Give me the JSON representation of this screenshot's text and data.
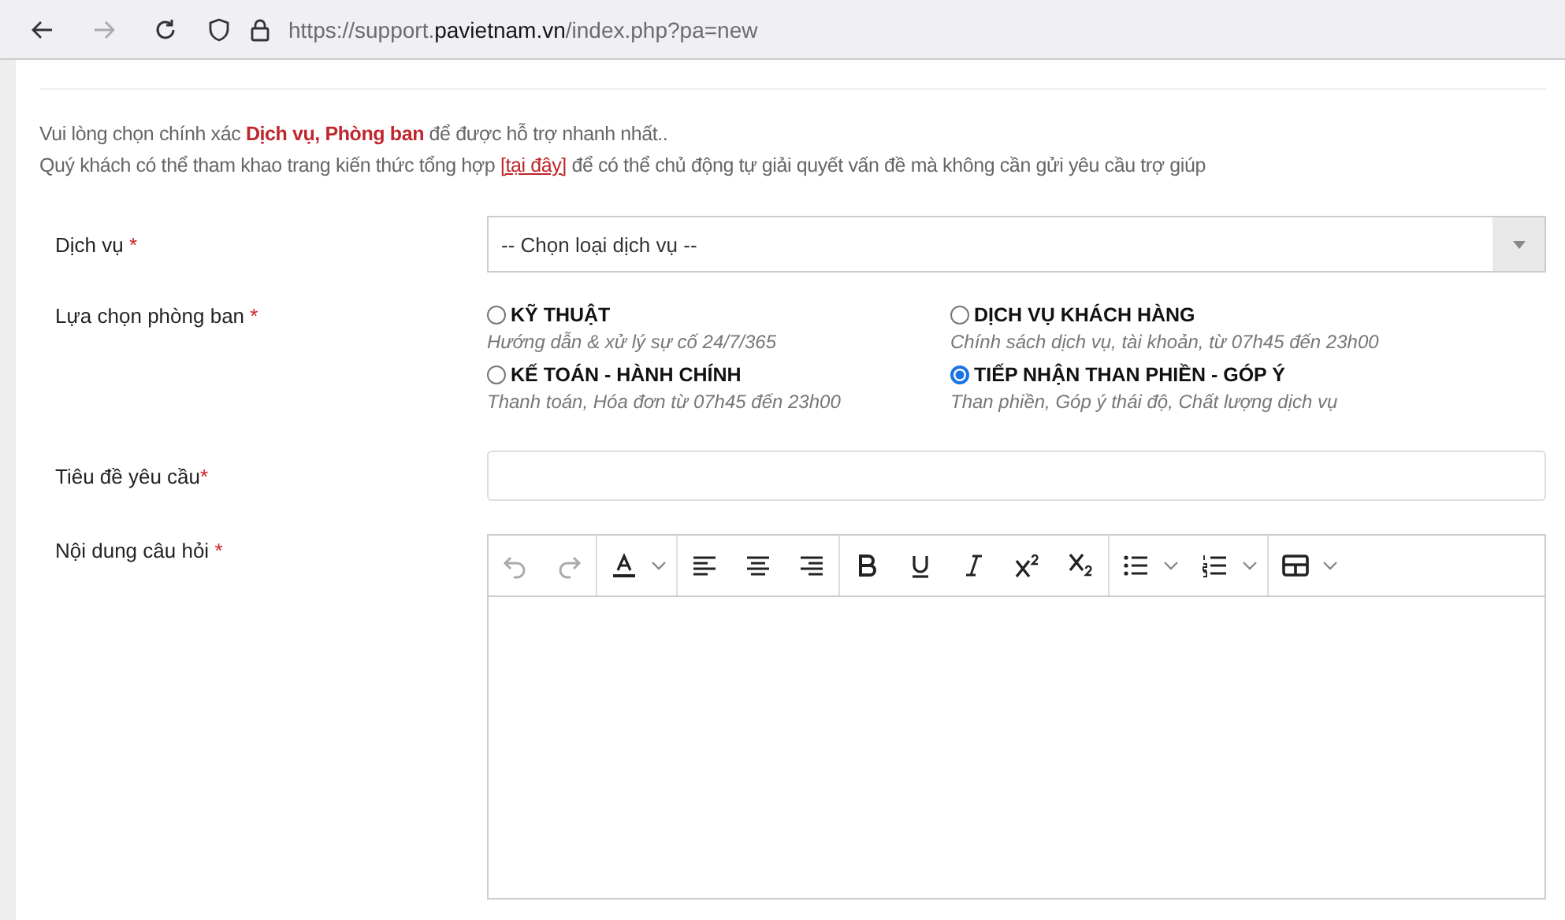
{
  "browser": {
    "url": {
      "scheme": "https://support.",
      "domain": "pavietnam.vn",
      "path": "/index.php?pa=new"
    }
  },
  "intro": {
    "line_1": "Vui lòng chọn chính xác **Dịch vụ, Phòng ban** để được hỗ trợ nhanh nhất..",
    "line_2_before": "Quý khách có thể tham khao trang kiến thức tổng hợp ",
    "line_2_link": "[tại đây]",
    "line_2_after": " để có thể chủ động tự giải quyết vấn đề mà không cần gửi yêu cầu trợ giúp"
  },
  "form": {
    "service": {
      "label": "Dịch vụ",
      "required_mark": "*",
      "placeholder": "-- Chọn loại dịch vụ --"
    },
    "department": {
      "label": "Lựa chọn phòng ban",
      "required_mark": "*",
      "options": [
        {
          "title": "KỸ THUẬT",
          "description": "Hướng dẫn & xử lý sự cố 24/7/365",
          "selected": false
        },
        {
          "title": "DỊCH VỤ KHÁCH HÀNG",
          "description": "Chính sách dịch vụ, tài khoản, từ 07h45 đến 23h00",
          "selected": false
        },
        {
          "title": "KẾ TOÁN - HÀNH CHÍNH",
          "description": "Thanh toán, Hóa đơn từ 07h45 đến 23h00",
          "selected": false
        },
        {
          "title": "TIẾP NHẬN THAN PHIỀN - GÓP Ý",
          "description": "Than phiền, Góp ý thái độ, Chất lượng dịch vụ",
          "selected": true
        }
      ]
    },
    "subject": {
      "label": "Tiêu đề yêu cầu",
      "required_mark": "*"
    },
    "content": {
      "label": "Nội dung câu hỏi",
      "required_mark": "*"
    }
  }
}
